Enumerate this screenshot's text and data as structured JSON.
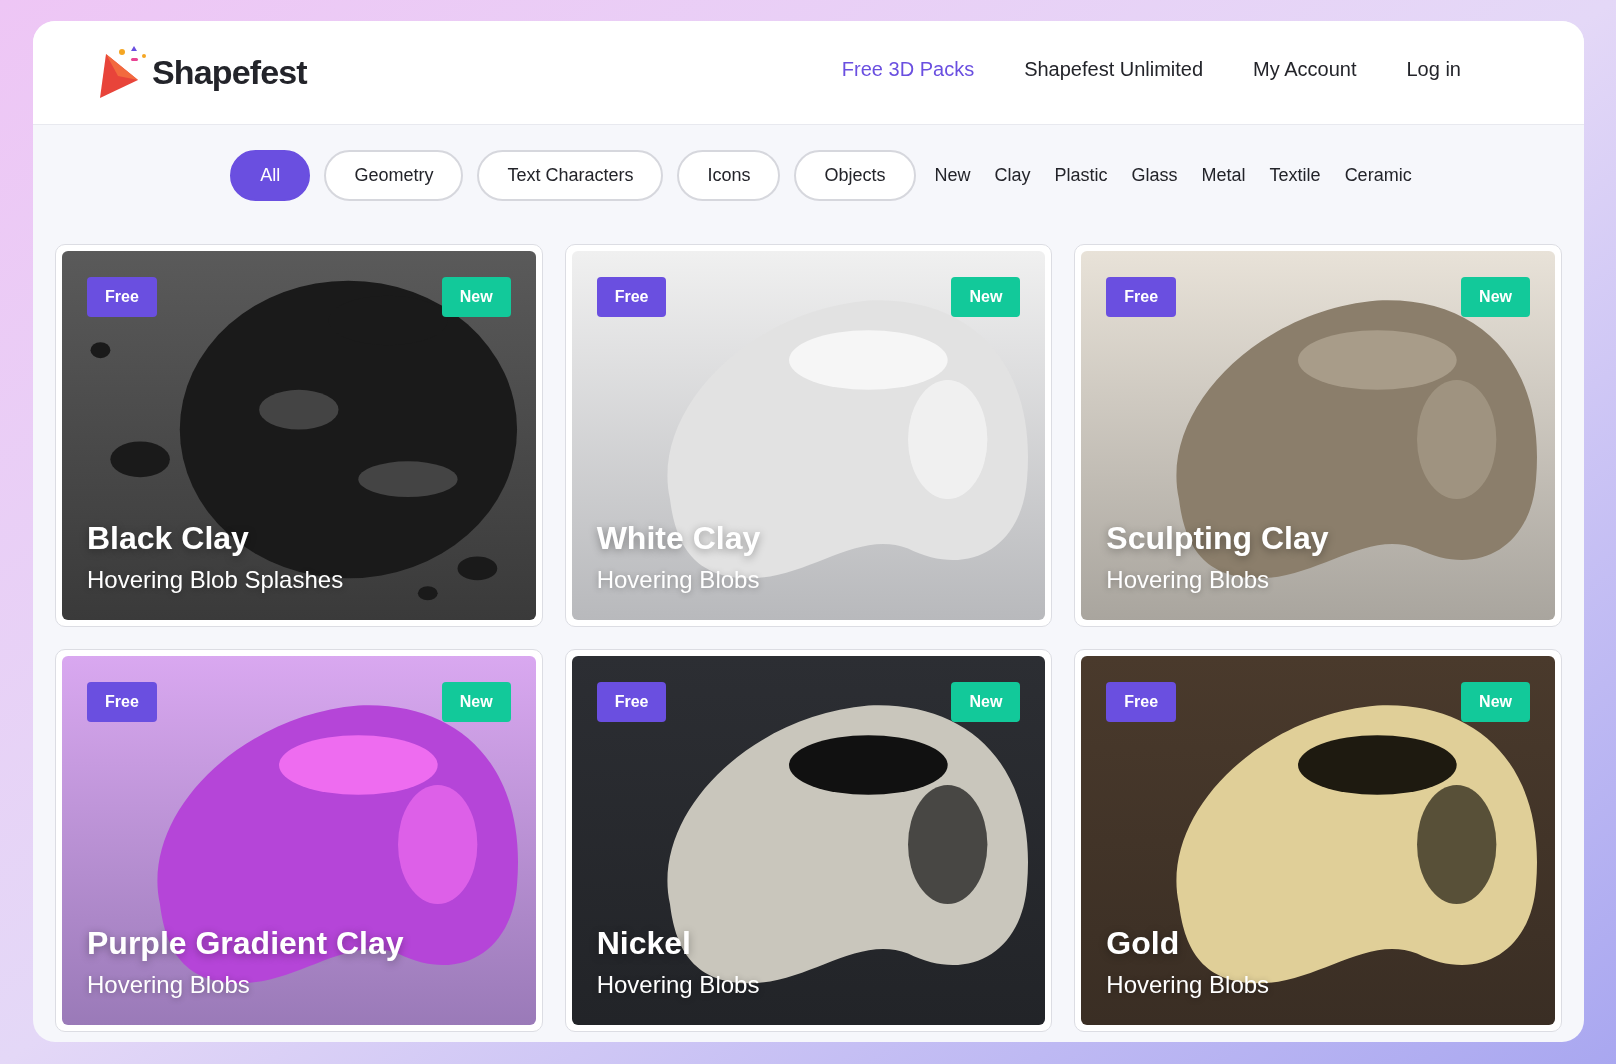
{
  "brand": {
    "name": "Shapefest"
  },
  "nav": [
    {
      "label": "Free 3D Packs",
      "selected": true
    },
    {
      "label": "Shapefest Unlimited",
      "selected": false
    },
    {
      "label": "My Account",
      "selected": false
    },
    {
      "label": "Log in",
      "selected": false
    }
  ],
  "filters": [
    {
      "label": "All",
      "kind": "pill",
      "selected": true
    },
    {
      "label": "Geometry",
      "kind": "pill",
      "selected": false
    },
    {
      "label": "Text Characters",
      "kind": "pill",
      "selected": false
    },
    {
      "label": "Icons",
      "kind": "pill",
      "selected": false
    },
    {
      "label": "Objects",
      "kind": "pill",
      "selected": false
    },
    {
      "label": "New",
      "kind": "link",
      "selected": false
    },
    {
      "label": "Clay",
      "kind": "link",
      "selected": false
    },
    {
      "label": "Plastic",
      "kind": "link",
      "selected": false
    },
    {
      "label": "Glass",
      "kind": "link",
      "selected": false
    },
    {
      "label": "Metal",
      "kind": "link",
      "selected": false
    },
    {
      "label": "Textile",
      "kind": "link",
      "selected": false
    },
    {
      "label": "Ceramic",
      "kind": "link",
      "selected": false
    }
  ],
  "cards": [
    {
      "title": "Black Clay",
      "subtitle": "Hovering Blob Splashes",
      "badges": [
        "Free",
        "New"
      ]
    },
    {
      "title": "White Clay",
      "subtitle": "Hovering Blobs",
      "badges": [
        "Free",
        "New"
      ]
    },
    {
      "title": "Sculpting Clay",
      "subtitle": "Hovering Blobs",
      "badges": [
        "Free",
        "New"
      ]
    },
    {
      "title": "Purple Gradient Clay",
      "subtitle": "Hovering Blobs",
      "badges": [
        "Free",
        "New"
      ]
    },
    {
      "title": "Nickel",
      "subtitle": "Hovering Blobs",
      "badges": [
        "Free",
        "New"
      ]
    },
    {
      "title": "Gold",
      "subtitle": "Hovering Blobs",
      "badges": [
        "Free",
        "New"
      ]
    }
  ]
}
